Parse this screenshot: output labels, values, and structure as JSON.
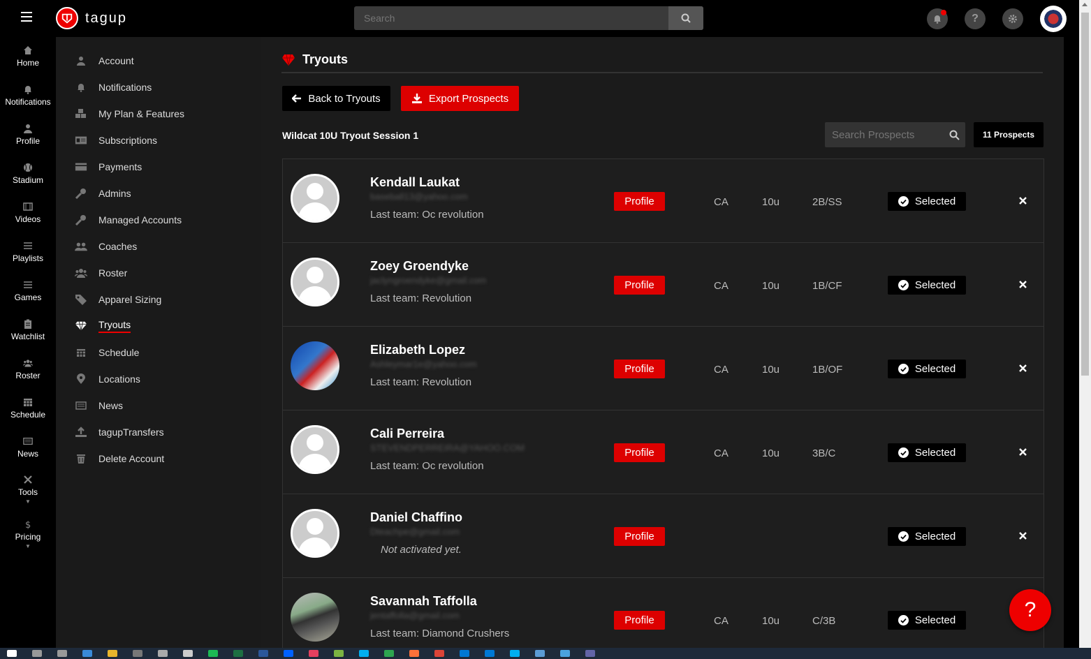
{
  "app": {
    "logo_text": "tagup"
  },
  "topbar": {
    "search_placeholder": "Search"
  },
  "rail": [
    {
      "label": "Home",
      "icon": "home-icon"
    },
    {
      "label": "Notifications",
      "icon": "bell-icon"
    },
    {
      "label": "Profile",
      "icon": "user-icon"
    },
    {
      "label": "Stadium",
      "icon": "ball-icon"
    },
    {
      "label": "Videos",
      "icon": "film-icon"
    },
    {
      "label": "Playlists",
      "icon": "list-icon"
    },
    {
      "label": "Games",
      "icon": "list-icon"
    },
    {
      "label": "Watchlist",
      "icon": "clipboard-icon"
    },
    {
      "label": "Roster",
      "icon": "group-icon"
    },
    {
      "label": "Schedule",
      "icon": "calendar-icon"
    },
    {
      "label": "News",
      "icon": "newspaper-icon"
    },
    {
      "label": "Tools",
      "icon": "tools-icon"
    },
    {
      "label": "Pricing",
      "icon": "dollar-icon"
    }
  ],
  "settings": [
    {
      "label": "Account",
      "icon": "user-icon"
    },
    {
      "label": "Notifications",
      "icon": "bell-icon"
    },
    {
      "label": "My Plan & Features",
      "icon": "cubes-icon"
    },
    {
      "label": "Subscriptions",
      "icon": "id-card-icon"
    },
    {
      "label": "Payments",
      "icon": "credit-card-icon"
    },
    {
      "label": "Admins",
      "icon": "key-icon"
    },
    {
      "label": "Managed Accounts",
      "icon": "key-icon"
    },
    {
      "label": "Coaches",
      "icon": "users-icon"
    },
    {
      "label": "Roster",
      "icon": "group-icon"
    },
    {
      "label": "Apparel Sizing",
      "icon": "tag-icon"
    },
    {
      "label": "Tryouts",
      "icon": "diamond-icon",
      "active": true
    },
    {
      "label": "Schedule",
      "icon": "calendar-icon"
    },
    {
      "label": "Locations",
      "icon": "map-pin-icon"
    },
    {
      "label": "News",
      "icon": "newspaper-icon"
    },
    {
      "label": "tagupTransfers",
      "icon": "upload-icon"
    },
    {
      "label": "Delete Account",
      "icon": "trash-icon"
    }
  ],
  "main": {
    "title": "Tryouts",
    "back_label": "Back to Tryouts",
    "export_label": "Export Prospects",
    "session": "Wildcat 10U Tryout Session 1",
    "search_placeholder": "Search Prospects",
    "count": "11 Prospects",
    "profile_label": "Profile",
    "selected_label": "Selected",
    "prospects": [
      {
        "name": "Kendall Laukat",
        "email": "baseball13@yahoo.com",
        "team": "Last team: Oc revolution",
        "state": "CA",
        "age": "10u",
        "pos": "2B/SS",
        "avatar": "default"
      },
      {
        "name": "Zoey Groendyke",
        "email": "jaclyngroendyke@gmail.com",
        "team": "Last team: Revolution",
        "state": "CA",
        "age": "10u",
        "pos": "1B/CF",
        "avatar": "default"
      },
      {
        "name": "Elizabeth Lopez",
        "email": "Ashleymar1e@yahoo.com",
        "team": "Last team: Revolution",
        "state": "CA",
        "age": "10u",
        "pos": "1B/OF",
        "avatar": "photo1"
      },
      {
        "name": "Cali Perreira",
        "email": "STEVENDPERREIRA@YAHOO.COM",
        "team": "Last team: Oc revolution",
        "state": "CA",
        "age": "10u",
        "pos": "3B/C",
        "avatar": "default"
      },
      {
        "name": "Daniel Chaffino",
        "email": "Dteachpe@gmail.com",
        "team": "Not activated yet.",
        "state": "",
        "age": "",
        "pos": "",
        "avatar": "default",
        "not_activated": true
      },
      {
        "name": "Savannah Taffolla",
        "email": "jentaffolla@gmail.com",
        "team": "Last team: Diamond Crushers",
        "state": "CA",
        "age": "10u",
        "pos": "C/3B",
        "avatar": "photo2"
      }
    ]
  },
  "help_label": "?",
  "colors": {
    "accent": "#dd0000",
    "background": "#1b1b1b"
  }
}
